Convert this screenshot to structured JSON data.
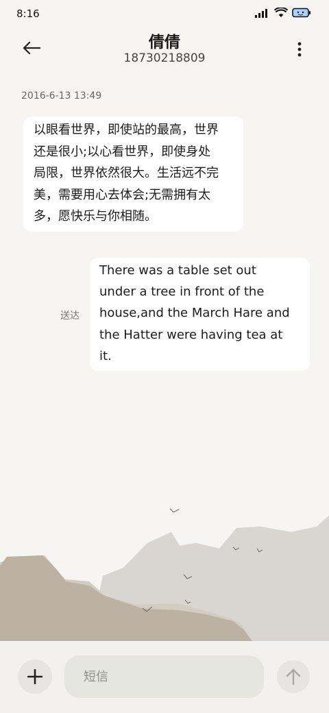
{
  "status_bar": {
    "time": "8:16",
    "icons": [
      "signal-icon",
      "wifi-icon",
      "battery-icon"
    ]
  },
  "header": {
    "contact_name": "倩倩",
    "contact_number": "18730218809",
    "back_icon": "back-arrow-icon",
    "more_icon": "more-vertical-icon"
  },
  "conversation": {
    "timestamp": "2016-6-13 13:49",
    "messages": [
      {
        "direction": "incoming",
        "lines": [
          "以眼看世界，即使站的最高，世界",
          "还是很小;以心看世界，即使身处",
          "局限，世界依然很大。生活远不完",
          "美，需要用心去体会;无需拥有太",
          "多，愿快乐与你相随。"
        ]
      },
      {
        "direction": "outgoing",
        "lines": [
          "There was a table set out",
          "under a tree in front of the",
          "house,and the March Hare and",
          "the Hatter were having tea at",
          "it."
        ],
        "status": "送达"
      }
    ]
  },
  "input_bar": {
    "add_icon": "plus-icon",
    "placeholder": "短信",
    "send_icon": "arrow-up-icon"
  },
  "colors": {
    "background": "#f6f5f2",
    "bubble": "#ffffff",
    "mountain_dark": "#bcb2a3",
    "mountain_light": "#d9d5d0"
  }
}
